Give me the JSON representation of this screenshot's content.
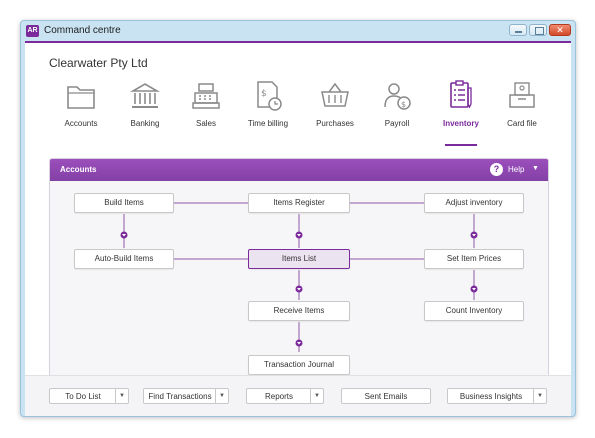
{
  "window": {
    "app_logo": "AR",
    "title": "Command centre"
  },
  "company": "Clearwater Pty Ltd",
  "nav": [
    {
      "label": "Accounts",
      "icon": "folder-icon"
    },
    {
      "label": "Banking",
      "icon": "bank-icon"
    },
    {
      "label": "Sales",
      "icon": "cash-register-icon"
    },
    {
      "label": "Time billing",
      "icon": "time-billing-icon"
    },
    {
      "label": "Purchases",
      "icon": "basket-icon"
    },
    {
      "label": "Payroll",
      "icon": "payroll-icon"
    },
    {
      "label": "Inventory",
      "icon": "inventory-icon",
      "active": true
    },
    {
      "label": "Card file",
      "icon": "card-file-icon"
    }
  ],
  "panel": {
    "title": "Accounts",
    "help_symbol": "?",
    "help_label": "Help",
    "help_caret": "▼"
  },
  "flow": {
    "build_items": "Build Items",
    "items_register": "Items Register",
    "adjust_inventory": "Adjust inventory",
    "auto_build_items": "Auto-Build Items",
    "items_list": "Items List",
    "set_item_prices": "Set Item Prices",
    "receive_items": "Receive Items",
    "count_inventory": "Count Inventory",
    "transaction_journal": "Transaction Journal"
  },
  "bottom": {
    "todo": "To Do List",
    "find": "Find Transactions",
    "reports": "Reports",
    "sent_emails": "Sent Emails",
    "insights": "Business Insights",
    "caret": "▼"
  },
  "colors": {
    "accent": "#7a2a9a",
    "panel_header": "#8c45ad",
    "window_frame": "#c9e3f3",
    "close_button": "#d9553a"
  }
}
